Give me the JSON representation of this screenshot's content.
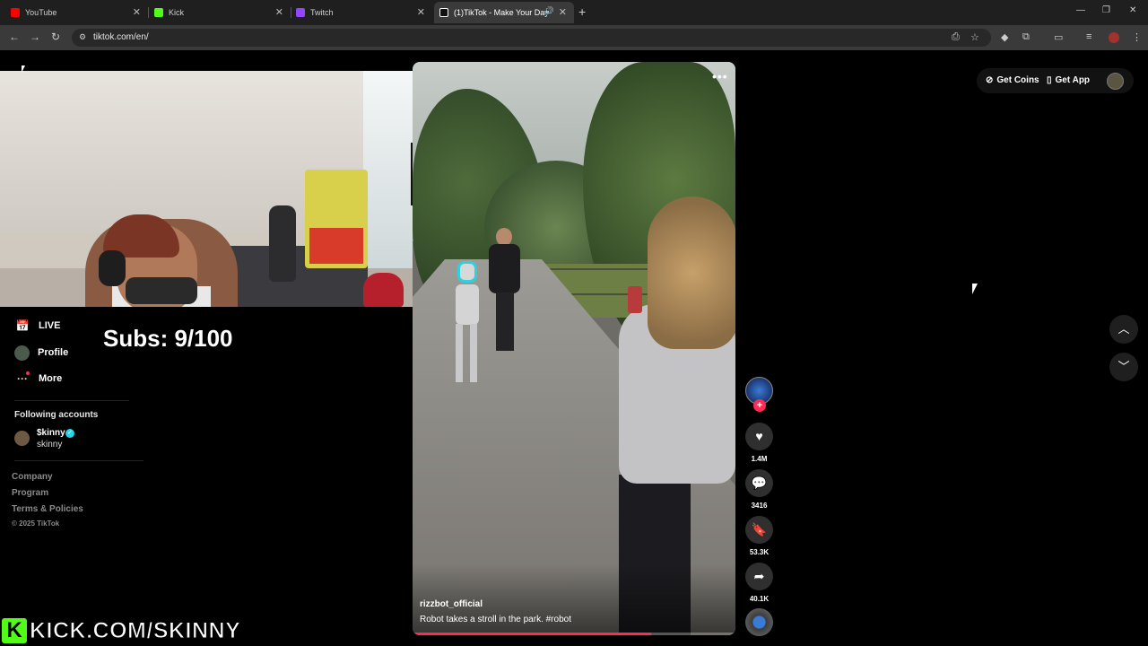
{
  "browser": {
    "tabs": [
      {
        "label": "YouTube",
        "favicon_color": "#ff0000"
      },
      {
        "label": "Kick",
        "favicon_color": "#53fc18"
      },
      {
        "label": "Twitch",
        "favicon_color": "#9146ff"
      },
      {
        "label": "(1)TikTok - Make Your Day",
        "favicon_color": "#ffffff"
      }
    ],
    "new_tab_icon": "plus-icon",
    "url": "tiktok.com/en/"
  },
  "overlay": {
    "subs_text": "Subs: 9/100",
    "kick_logo": "K",
    "kick_text": "KICK.COM/SKINNY"
  },
  "nav": {
    "items": [
      {
        "label": "LIVE",
        "icon": "live-icon"
      },
      {
        "label": "Profile",
        "icon": "avatar"
      },
      {
        "label": "More",
        "icon": "more-icon"
      }
    ],
    "following_title": "Following accounts",
    "following": [
      {
        "name": "$kinny",
        "handle": "skinny",
        "verified": true
      }
    ],
    "footer_links": [
      "Company",
      "Program",
      "Terms & Policies"
    ],
    "copyright": "© 2025 TikTok"
  },
  "video": {
    "author": "rizzbot_official",
    "caption": "Robot takes a stroll in the park. #robot",
    "progress": 0.74
  },
  "actions": {
    "likes": "1.4M",
    "comments": "3416",
    "saves": "53.3K",
    "shares": "40.1K"
  },
  "header": {
    "get_coins": "Get Coins",
    "get_app": "Get App"
  },
  "colors": {
    "accent": "#fe2c55",
    "kick_green": "#53fc18",
    "verified": "#20d5ec"
  }
}
